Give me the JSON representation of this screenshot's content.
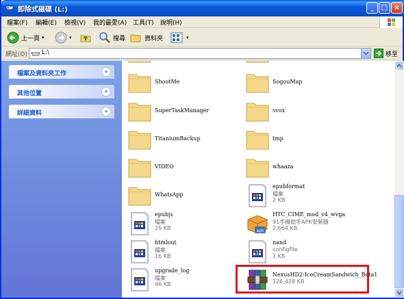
{
  "window": {
    "title": "卸除式磁碟 (L:)"
  },
  "menu": [
    "檔案(F)",
    "編輯(E)",
    "檢視(V)",
    "我的最愛(A)",
    "工具(T)",
    "說明(H)"
  ],
  "toolbar": {
    "back": "上一頁",
    "search": "搜尋",
    "folders": "資料夾"
  },
  "address": {
    "label": "網址(D)",
    "value": "L:\\",
    "go": "移至"
  },
  "tasks": [
    {
      "title": "檔案及資料夾工作"
    },
    {
      "title": "其他位置"
    },
    {
      "title": "詳細資料"
    }
  ],
  "items": [
    {
      "name": "ShootMe",
      "type": "folder"
    },
    {
      "name": "SogouMap",
      "type": "folder"
    },
    {
      "name": "SuperTaskManager",
      "type": "folder"
    },
    {
      "name": "svox",
      "type": "folder"
    },
    {
      "name": "TitaniumBackup",
      "type": "folder"
    },
    {
      "name": "tmp",
      "type": "folder"
    },
    {
      "name": "VIDEO",
      "type": "folder"
    },
    {
      "name": "whaaza",
      "type": "folder"
    },
    {
      "name": "WhatsApp",
      "type": "folder"
    },
    {
      "name": "epubformat",
      "kind": "檔案",
      "size": "2 KB",
      "type": "file"
    },
    {
      "name": "epubjs",
      "kind": "檔案",
      "size": "25 KB",
      "type": "file"
    },
    {
      "name": "HTC_CIME_mod_v4_wvga",
      "kind": "91手機助手APK安裝器",
      "size": "2,664 KB",
      "type": "apk"
    },
    {
      "name": "htmlout",
      "kind": "檔案",
      "size": "16 KB",
      "type": "file"
    },
    {
      "name": "nand",
      "kind": "configfile",
      "size": "1 KB",
      "type": "file"
    },
    {
      "name": "upgrade_log",
      "kind": "檔案",
      "size": "46 KB",
      "type": "file"
    },
    {
      "name": "NexusHD2-IceCreamSandwich_Beta1",
      "size": "126,428 KB",
      "type": "rar"
    }
  ]
}
